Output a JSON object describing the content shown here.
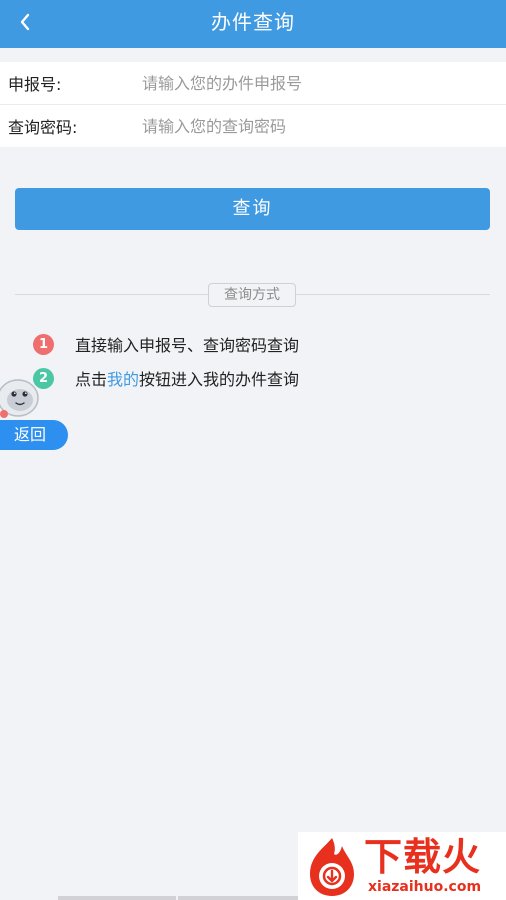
{
  "header": {
    "title": "办件查询"
  },
  "form": {
    "application_no_label": "申报号:",
    "application_no_placeholder": "请输入您的办件申报号",
    "password_label": "查询密码:",
    "password_placeholder": "请输入您的查询密码"
  },
  "query_button": "查询",
  "methods": {
    "section_title": "查询方式",
    "items": [
      {
        "number": "1",
        "text": "直接输入申报号、查询密码查询"
      },
      {
        "number": "2",
        "text_before": "点击",
        "link": "我的",
        "text_after": "按钮进入我的办件查询"
      }
    ]
  },
  "floating": {
    "return_label": "返回"
  },
  "watermark": {
    "title": "下载火",
    "url": "xiazaihuo.com"
  },
  "colors": {
    "header_bg": "#3f9ae2",
    "page_bg": "#f2f3f7",
    "accent": "#3f9ae2",
    "badge_1": "#ef6f6e",
    "badge_2": "#4cc7a6",
    "watermark_red": "#e8301e"
  },
  "icons": {
    "back": "chevron-left-icon",
    "mascot": "mascot-icon",
    "watermark_logo": "flame-logo"
  }
}
